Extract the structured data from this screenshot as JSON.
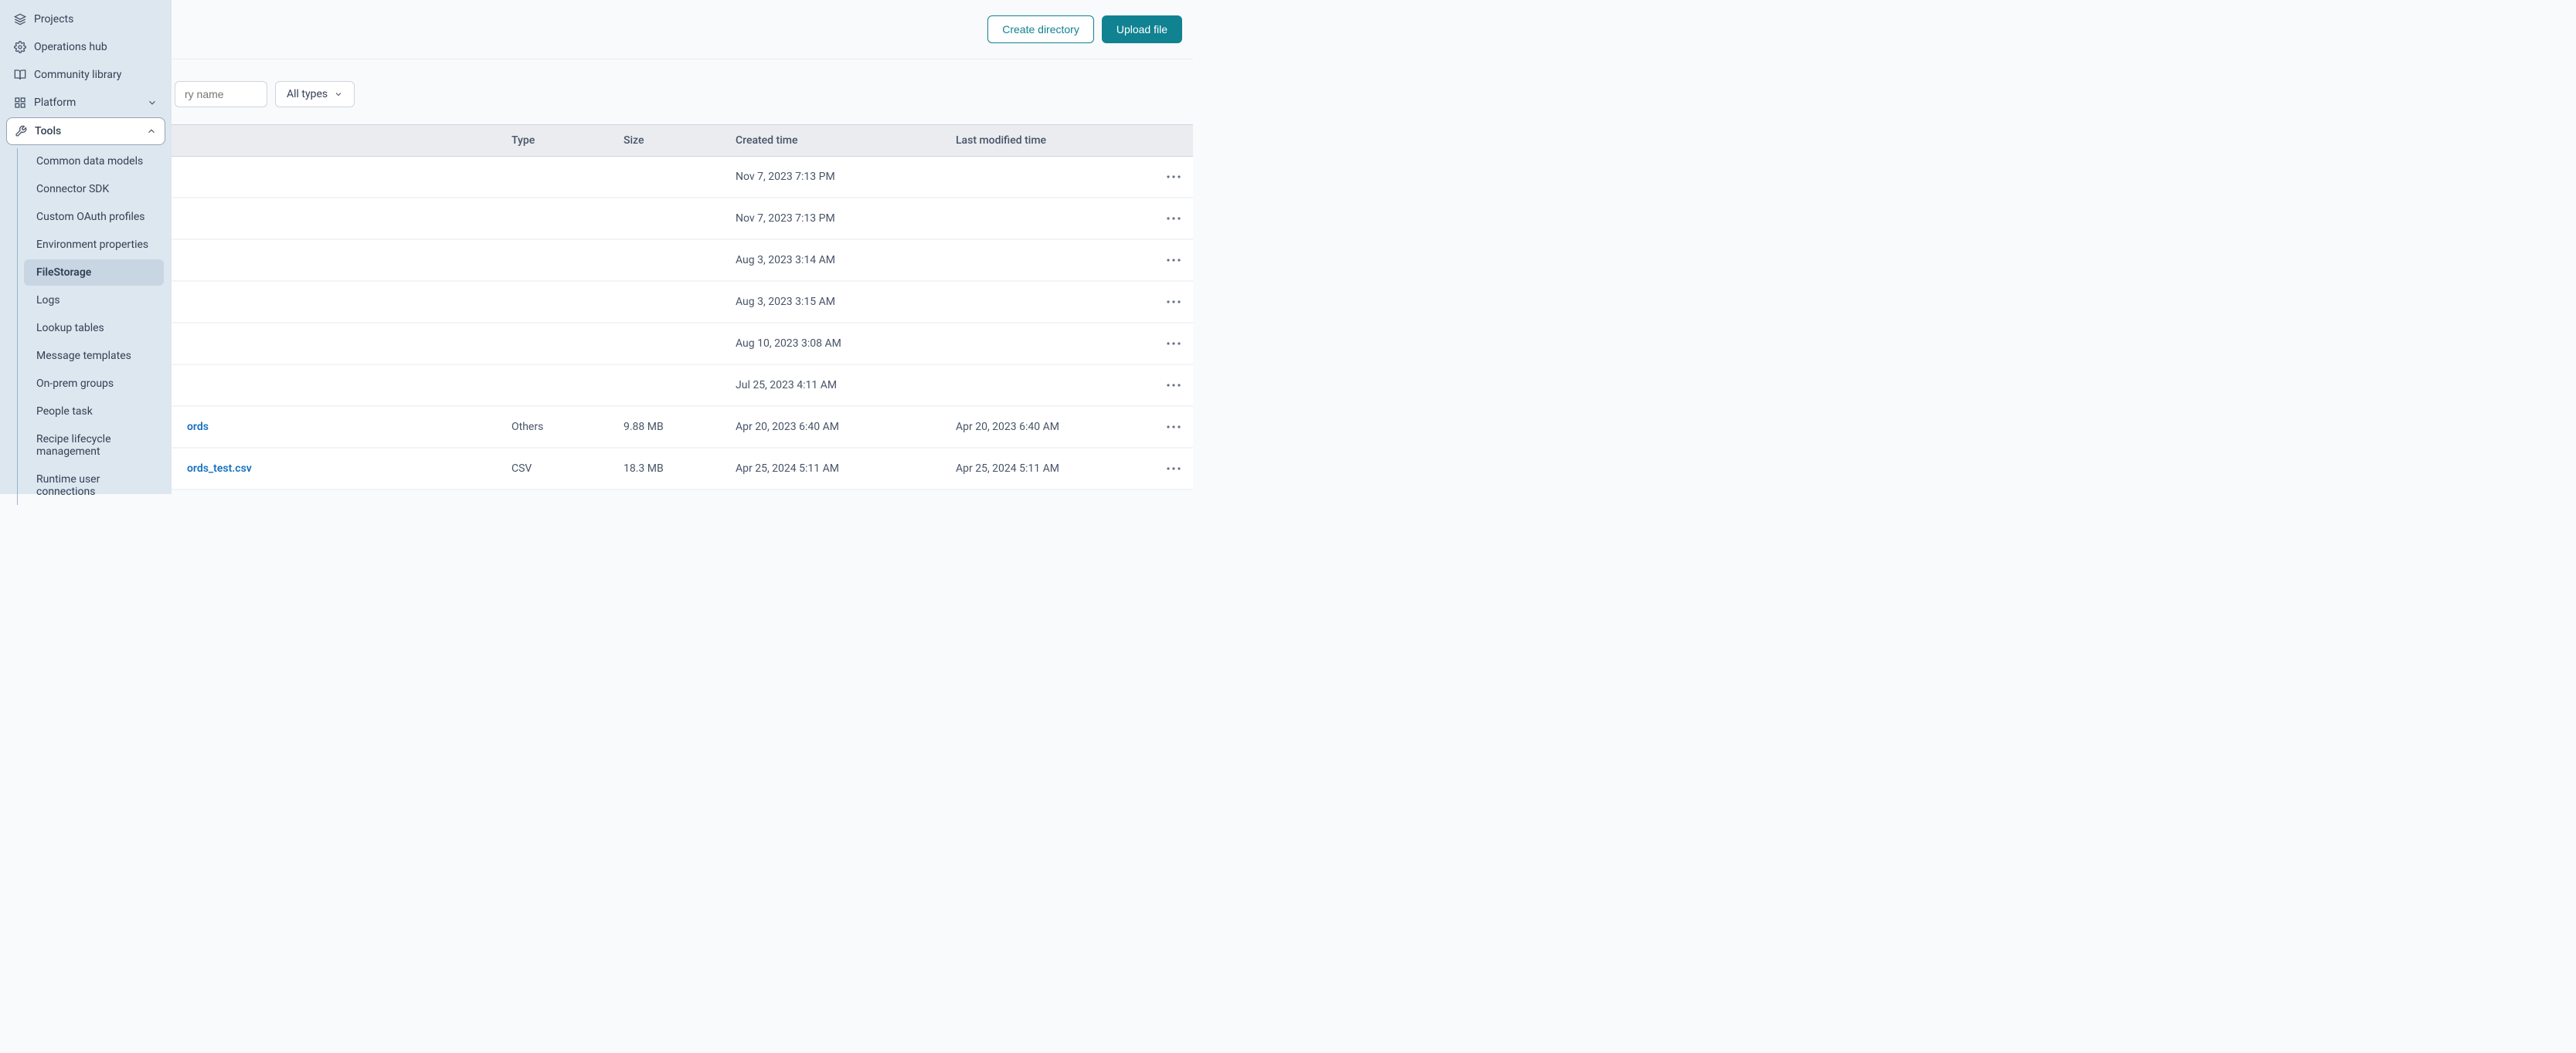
{
  "sidebar": {
    "items": [
      {
        "label": "Projects"
      },
      {
        "label": "Operations hub"
      },
      {
        "label": "Community library"
      },
      {
        "label": "Platform"
      },
      {
        "label": "Tools"
      }
    ],
    "tools_submenu": [
      {
        "label": "Common data models"
      },
      {
        "label": "Connector SDK"
      },
      {
        "label": "Custom OAuth profiles"
      },
      {
        "label": "Environment properties"
      },
      {
        "label": "FileStorage"
      },
      {
        "label": "Logs"
      },
      {
        "label": "Lookup tables"
      },
      {
        "label": "Message templates"
      },
      {
        "label": "On-prem groups"
      },
      {
        "label": "People task"
      },
      {
        "label": "Recipe lifecycle management"
      },
      {
        "label": "Runtime user connections"
      }
    ]
  },
  "toolbar": {
    "create_directory": "Create directory",
    "upload_file": "Upload file"
  },
  "filters": {
    "search_placeholder": "ry name",
    "type_filter": "All types"
  },
  "table": {
    "headers": {
      "name": "",
      "type": "Type",
      "size": "Size",
      "created": "Created time",
      "modified": "Last modified time"
    },
    "rows": [
      {
        "name": "",
        "type": "",
        "size": "",
        "created": "Nov 7, 2023 7:13 PM",
        "modified": ""
      },
      {
        "name": "",
        "type": "",
        "size": "",
        "created": "Nov 7, 2023 7:13 PM",
        "modified": ""
      },
      {
        "name": "",
        "type": "",
        "size": "",
        "created": "Aug 3, 2023 3:14 AM",
        "modified": ""
      },
      {
        "name": "",
        "type": "",
        "size": "",
        "created": "Aug 3, 2023 3:15 AM",
        "modified": ""
      },
      {
        "name": "",
        "type": "",
        "size": "",
        "created": "Aug 10, 2023 3:08 AM",
        "modified": ""
      },
      {
        "name": "",
        "type": "",
        "size": "",
        "created": "Jul 25, 2023 4:11 AM",
        "modified": ""
      },
      {
        "name": "ords",
        "type": "Others",
        "size": "9.88 MB",
        "created": "Apr 20, 2023 6:40 AM",
        "modified": "Apr 20, 2023 6:40 AM"
      },
      {
        "name": "ords_test.csv",
        "type": "CSV",
        "size": "18.3 MB",
        "created": "Apr 25, 2024 5:11 AM",
        "modified": "Apr 25, 2024 5:11 AM"
      }
    ]
  }
}
